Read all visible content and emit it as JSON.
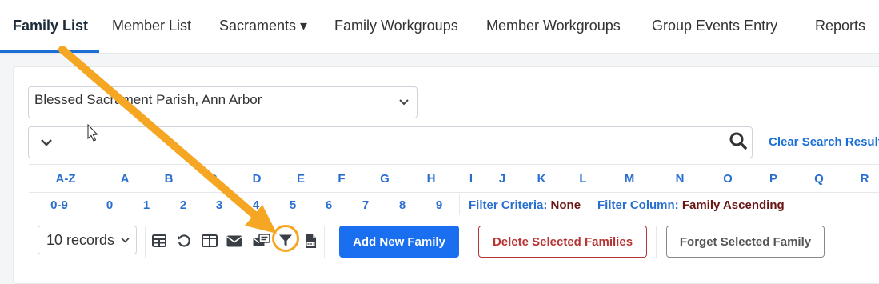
{
  "nav": {
    "tabs": [
      {
        "label": "Family List",
        "active": true
      },
      {
        "label": "Member List"
      },
      {
        "label": "Sacraments ▾"
      },
      {
        "label": "Family Workgroups"
      },
      {
        "label": "Member Workgroups"
      },
      {
        "label": "Group Events Entry"
      },
      {
        "label": "Reports"
      }
    ]
  },
  "parish_select": {
    "value": "Blessed Sacrament Parish, Ann Arbor"
  },
  "search": {
    "clear_label": "Clear Search Result"
  },
  "alpha_filter": [
    "A-Z",
    "A",
    "B",
    "C",
    "D",
    "E",
    "F",
    "G",
    "H",
    "I",
    "J",
    "K",
    "L",
    "M",
    "N",
    "O",
    "P",
    "Q",
    "R"
  ],
  "num_filter": [
    "0-9",
    "0",
    "1",
    "2",
    "3",
    "4",
    "5",
    "6",
    "7",
    "8",
    "9"
  ],
  "filter_info": {
    "criteria_label": "Filter Criteria:",
    "criteria_value": "None",
    "column_label": "Filter Column:",
    "column_value": "Family Ascending"
  },
  "toolbar": {
    "records_value": "10 records",
    "icons": [
      "table-icon",
      "undo-icon",
      "columns-icon",
      "email-icon",
      "mail-merge-icon",
      "filter-icon",
      "csv-file-icon"
    ],
    "add_label": "Add New Family",
    "delete_label": "Delete Selected Families",
    "forget_label": "Forget Selected Family"
  },
  "colors": {
    "accent": "#1a6fd6",
    "highlight": "#f5a623",
    "danger": "#b53434",
    "filter_value": "#6b1414"
  }
}
